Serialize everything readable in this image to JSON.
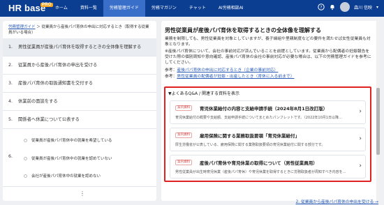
{
  "header": {
    "logo": "HR base",
    "logo_badge": "PRO",
    "nav": [
      "ホーム",
      "資料一覧",
      "労務管理ガイド",
      "労務マガジン",
      "チャット",
      "AI労務相談AI"
    ],
    "active_nav": 2,
    "user_name": "森川 信映"
  },
  "left": {
    "breadcrumb_link": "労務管理ガイド",
    "breadcrumb_rest": " ＞ 従業員から産後パパ育休の申出に対応するとき（取得する従業員がいる場合）",
    "toc": [
      {
        "num": "1.",
        "label": "男性従業員が産後パパ育休を取得するときの全体像を理解する"
      },
      {
        "num": "2.",
        "label": "従業員から産後パパ育休の申出を受ける"
      },
      {
        "num": "3.",
        "label": "産後パパ育休の取扱通知書を交付する"
      },
      {
        "num": "4.",
        "label": "休業前の面談をする"
      },
      {
        "num": "5.",
        "label": "関係者へ休業について公表する"
      }
    ],
    "sub_num": "6.",
    "sub_items": [
      "従業員が産後パパ育休中の就業を希望している",
      "従業員が産後パパ育休中の就業を認めていない",
      "会社が産後パパ育休中の就業を認めない"
    ],
    "more": "⋮"
  },
  "right": {
    "title": "男性従業員が産後パパ育休を取得するときの全体像を理解する",
    "para1": "業務を制限しても、男性従業員を対象としていますが、養子縁組や里親制度などの要件を満たせば女性従業員も対象となります。",
    "para2": "※産後パパ育休について、会社の事前対応が済んでいることを前提としています。従業員から配偶者の妊娠報告を受けた際の個別周知や意向確認、産後パパ育休の会社の事前対応が必要な場合は、以下の労務管理ガイドを参考にしてください。",
    "ref1_prefix": "参考：",
    "ref1_link": "産後パパ育休の申出に対応するとき（企業の事前対応）",
    "ref2_prefix": "参考：",
    "ref2_link": "男性従業員の配偶者が妊娠・出産したとき（育休に入る前まで）",
    "faq_heading": "▼よくあるQ&A / 関連する資料を表示",
    "cards": [
      {
        "badge": "案内資料",
        "title": "育児休業給付の内容と支給申請手続（2024年8月1日改訂版）",
        "desc": "育児休業給付の概要や支給額、支給申請手続についてまとめたパンフレットです。（2022年10月1日以降…"
      },
      {
        "badge": "案内資料",
        "title": "雇用保険に関する業務取扱要領「育児休業給付」",
        "desc": "厚生労働省が公表している、雇用保険に関する業務取扱要領の育児休業給付に関する部分です。"
      },
      {
        "badge": "案内資料",
        "title": "産後パパ育休や育児休業の取得について（男性従業員用）",
        "desc": "男性従業員が出生時育児休業（産後パパ育休）や育児休業を取得するときに労務取扱者が周知すべき内容を…"
      }
    ],
    "next_link": "2. 従業員から産後パパ育休の申出を受ける →"
  }
}
